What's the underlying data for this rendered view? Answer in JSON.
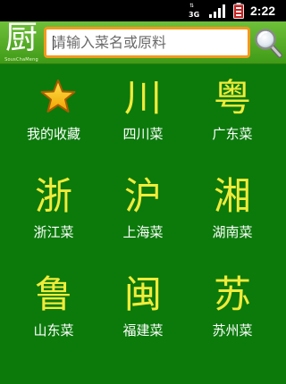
{
  "status_bar": {
    "network": "3G",
    "clock": "2:22",
    "icons": [
      "3g-data-icon",
      "signal-icon",
      "battery-icon"
    ]
  },
  "header": {
    "logo_char": "厨",
    "logo_sub": "SousChaMeng",
    "search": {
      "placeholder": "请输入菜名或原料",
      "value": ""
    },
    "search_button_icon": "magnifier-icon"
  },
  "categories": [
    {
      "glyph": "",
      "icon": "star-icon",
      "label": "我的收藏"
    },
    {
      "glyph": "川",
      "label": "四川菜"
    },
    {
      "glyph": "粤",
      "label": "广东菜"
    },
    {
      "glyph": "浙",
      "label": "浙江菜"
    },
    {
      "glyph": "沪",
      "label": "上海菜"
    },
    {
      "glyph": "湘",
      "label": "湖南菜"
    },
    {
      "glyph": "鲁",
      "label": "山东菜"
    },
    {
      "glyph": "闽",
      "label": "福建菜"
    },
    {
      "glyph": "苏",
      "label": "苏州菜"
    }
  ],
  "colors": {
    "background": "#0b7a0b",
    "glyph": "#f1eb3a",
    "search_border": "#f29a1e",
    "header": "#4fa51f"
  }
}
